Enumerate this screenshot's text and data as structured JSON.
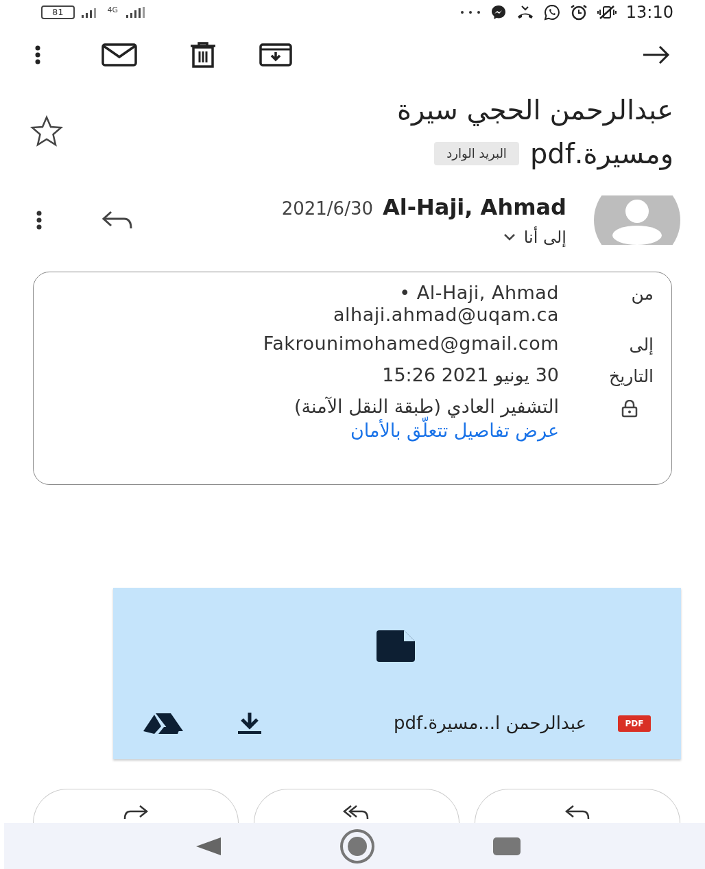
{
  "status_bar": {
    "battery": "81",
    "network": "4G",
    "time": "13:10"
  },
  "email": {
    "subject_lines": [
      "عبدالرحمن الحجي سيرة",
      "ومسيرة.pdf"
    ],
    "label": "البريد الوارد",
    "starred": false
  },
  "sender": {
    "name": "Al-Haji, Ahmad",
    "date": "2021/6/30",
    "recipients": "إلى أنا"
  },
  "details": [
    {
      "kind": "field",
      "label": "من",
      "lines": [
        "• Al-Haji, Ahmad",
        "alhaji.ahmad@uqam.ca"
      ]
    },
    {
      "kind": "field",
      "label": "إلى",
      "lines": [
        "Fakrounimohamed@gmail.com"
      ]
    },
    {
      "kind": "field",
      "label": "التاريخ",
      "lines": [
        "30 يونيو 2021 15:26"
      ]
    },
    {
      "kind": "security",
      "lines": [
        "التشفير العادي (طبقة النقل الآمنة)"
      ],
      "link": "عرض تفاصيل تتعلّق بالأمان"
    }
  ],
  "attachment": {
    "type": "PDF",
    "name": "عبدالرحمن ا...مسيرة.pdf"
  }
}
